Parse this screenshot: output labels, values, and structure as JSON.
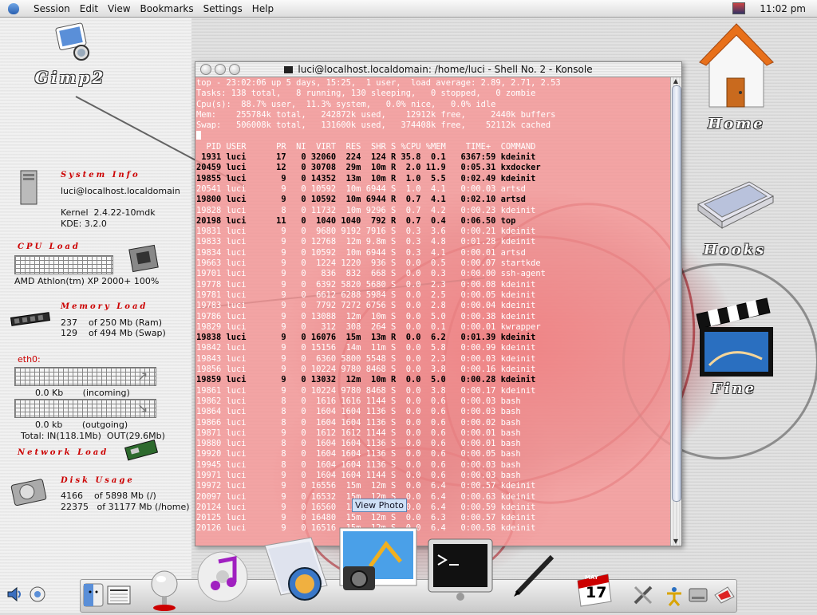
{
  "menubar": {
    "items": [
      "Session",
      "Edit",
      "View",
      "Bookmarks",
      "Settings",
      "Help"
    ],
    "clock": "11:02 pm"
  },
  "desktop_icons": {
    "gimp": "Gimp2",
    "home": "Home",
    "hooks": "Hooks",
    "fine": "Fine"
  },
  "monitor": {
    "system_title": "System Info",
    "user": "luci@localhost.localdomain",
    "kernel": "Kernel  2.4.22-10mdk",
    "kde": "KDE: 3.2.0",
    "cpu_title": "CPU Load",
    "cpu": "AMD Athlon(tm) XP 2000+ 100%",
    "mem_title": "Memory Load",
    "ram": "237    of 250 Mb (Ram)",
    "swap": "129    of 494 Mb (Swap)",
    "eth_label": "eth0:",
    "incoming": "0.0 Kb       (incoming)",
    "outgoing": "0.0 kb       (outgoing)",
    "total": "Total: IN(118.1Mb)  OUT(29.6Mb)",
    "network_title": "Network Load",
    "disk_title": "Disk Usage",
    "disk_root": "4166    of 5898 Mb (/)",
    "disk_home": "22375   of 31177 Mb (/home)"
  },
  "konsole": {
    "title": "luci@localhost.localdomain: /home/luci - Shell No. 2 - Konsole",
    "header": [
      "top - 23:02:06 up 5 days, 15:25,  1 user,  load average: 2.89, 2.71, 2.53",
      "Tasks: 138 total,   8 running, 130 sleeping,   0 stopped,   0 zombie",
      "Cpu(s):  88.7% user,  11.3% system,   0.0% nice,   0.0% idle",
      "Mem:    255784k total,   242872k used,    12912k free,     2440k buffers",
      "Swap:   506008k total,   131600k used,   374408k free,    52112k cached"
    ],
    "columns": "  PID USER      PR  NI  VIRT  RES  SHR S %CPU %MEM    TIME+  COMMAND",
    "rows": [
      {
        "t": " 1931 luci      17   0 32060  224  124 R 35.8  0.1   6367:59 kdeinit",
        "b": true
      },
      {
        "t": "20459 luci      12   0 30708  29m  10m R  2.0 11.9   0:05.31 kxdocker",
        "b": true
      },
      {
        "t": "19855 luci       9   0 14352  13m  10m R  1.0  5.5   0:02.49 kdeinit",
        "b": true
      },
      {
        "t": "20541 luci       9   0 10592  10m 6944 S  1.0  4.1   0:00.03 artsd",
        "b": false
      },
      {
        "t": "19800 luci       9   0 10592  10m 6944 R  0.7  4.1   0:02.10 artsd",
        "b": true
      },
      {
        "t": "19828 luci       8   0 11732  10m 9296 S  0.7  4.2   0:00.23 kdeinit",
        "b": false
      },
      {
        "t": "20198 luci      11   0  1040 1040  792 R  0.7  0.4   0:06.50 top",
        "b": true
      },
      {
        "t": "19831 luci       9   0  9680 9192 7916 S  0.3  3.6   0:00.21 kdeinit",
        "b": false
      },
      {
        "t": "19833 luci       9   0 12768  12m 9.8m S  0.3  4.8   0:01.28 kdeinit",
        "b": false
      },
      {
        "t": "19834 luci       9   0 10592  10m 6944 S  0.3  4.1   0:00.01 artsd",
        "b": false
      },
      {
        "t": "19663 luci       9   0  1224 1220  936 S  0.0  0.5   0:00.07 startkde",
        "b": false
      },
      {
        "t": "19701 luci       9   0   836  832  668 S  0.0  0.3   0:00.00 ssh-agent",
        "b": false
      },
      {
        "t": "19778 luci       9   0  6392 5820 5680 S  0.0  2.3   0:00.08 kdeinit",
        "b": false
      },
      {
        "t": "19781 luci       9   0  6612 6288 5984 S  0.0  2.5   0:00.05 kdeinit",
        "b": false
      },
      {
        "t": "19783 luci       9   0  7792 7272 6756 S  0.0  2.8   0:00.04 kdeinit",
        "b": false
      },
      {
        "t": "19786 luci       9   0 13088  12m  10m S  0.0  5.0   0:00.38 kdeinit",
        "b": false
      },
      {
        "t": "19829 luci       9   0   312  308  264 S  0.0  0.1   0:00.01 kwrapper",
        "b": false
      },
      {
        "t": "19838 luci       9   0 16076  15m  13m R  0.0  6.2   0:01.39 kdeinit",
        "b": true
      },
      {
        "t": "19842 luci       9   0 15156  14m  11m S  0.0  5.8   0:00.99 kdeinit",
        "b": false
      },
      {
        "t": "19843 luci       9   0  6360 5800 5548 S  0.0  2.3   0:00.03 kdeinit",
        "b": false
      },
      {
        "t": "19856 luci       9   0 10224 9780 8468 S  0.0  3.8   0:00.16 kdeinit",
        "b": false
      },
      {
        "t": "19859 luci       9   0 13032  12m  10m R  0.0  5.0   0:00.28 kdeinit",
        "b": true
      },
      {
        "t": "19861 luci       9   0 10224 9780 8468 S  0.0  3.8   0:00.17 kdeinit",
        "b": false
      },
      {
        "t": "19862 luci       8   0  1616 1616 1144 S  0.0  0.6   0:00.03 bash",
        "b": false
      },
      {
        "t": "19864 luci       8   0  1604 1604 1136 S  0.0  0.6   0:00.03 bash",
        "b": false
      },
      {
        "t": "19866 luci       8   0  1604 1604 1136 S  0.0  0.6   0:00.02 bash",
        "b": false
      },
      {
        "t": "19871 luci       9   0  1612 1612 1144 S  0.0  0.6   0:00.01 bash",
        "b": false
      },
      {
        "t": "19880 luci       8   0  1604 1604 1136 S  0.0  0.6   0:00.01 bash",
        "b": false
      },
      {
        "t": "19920 luci       8   0  1604 1604 1136 S  0.0  0.6   0:00.05 bash",
        "b": false
      },
      {
        "t": "19945 luci       8   0  1604 1604 1136 S  0.0  0.6   0:00.03 bash",
        "b": false
      },
      {
        "t": "19971 luci       9   0  1604 1604 1144 S  0.0  0.6   0:00.03 bash",
        "b": false
      },
      {
        "t": "19972 luci       9   0 16556  15m  12m S  0.0  6.4   0:00.57 kdeinit",
        "b": false
      },
      {
        "t": "20097 luci       9   0 16532  15m  12m S  0.0  6.4   0:00.63 kdeinit",
        "b": false
      },
      {
        "t": "20124 luci       9   0 16560  15m  12m S  0.0  6.4   0:00.59 kdeinit",
        "b": false
      },
      {
        "t": "20125 luci       9   0 16480  15m  12m S  0.0  6.3   0:00.57 kdeinit",
        "b": false
      },
      {
        "t": "20126 luci       9   0 16516  15m  12m S  0.0  6.4   0:00.58 kdeinit",
        "b": false
      }
    ]
  },
  "tooltip": "View Photo",
  "dock": {
    "calendar_day": "17",
    "calendar_month": "MAY"
  },
  "colors": {
    "accent_red": "#cc0000",
    "terminal_bg": "#f69696",
    "menubar": "#e8e8e8"
  }
}
